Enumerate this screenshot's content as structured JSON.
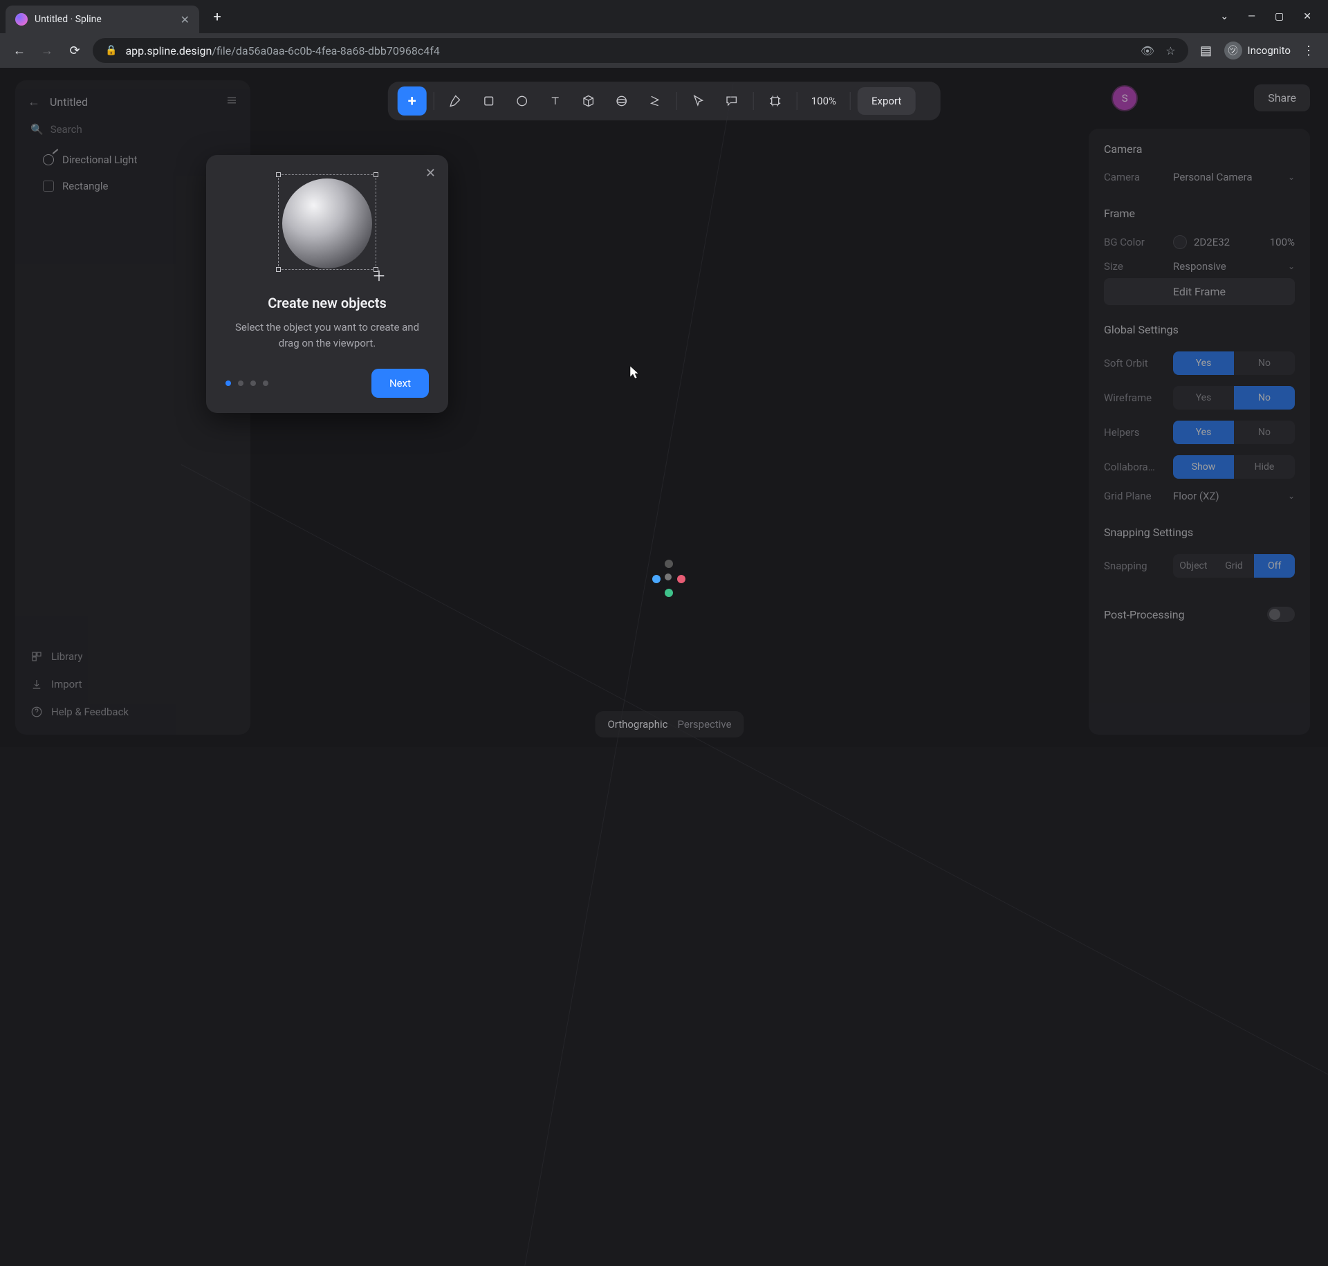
{
  "browser": {
    "tab_title": "Untitled · Spline",
    "url_host": "app.spline.design",
    "url_path": "/file/da56a0aa-6c0b-4fea-8a68-dbb70968c4f4",
    "incognito_label": "Incognito"
  },
  "left_panel": {
    "title": "Untitled",
    "search_placeholder": "Search",
    "items": [
      {
        "label": "Directional Light",
        "icon": "light"
      },
      {
        "label": "Rectangle",
        "icon": "rect"
      }
    ],
    "footer": {
      "library": "Library",
      "import": "Import",
      "help": "Help & Feedback"
    }
  },
  "toolbar": {
    "zoom": "100%",
    "export_label": "Export"
  },
  "share": {
    "avatar_initial": "S",
    "share_label": "Share"
  },
  "inspector": {
    "camera": {
      "section": "Camera",
      "label": "Camera",
      "value": "Personal Camera"
    },
    "frame": {
      "section": "Frame",
      "bgcolor_label": "BG Color",
      "bgcolor_hex": "2D2E32",
      "bgcolor_opacity": "100%",
      "size_label": "Size",
      "size_value": "Responsive",
      "edit_label": "Edit Frame"
    },
    "global": {
      "section": "Global Settings",
      "soft_orbit": {
        "label": "Soft Orbit",
        "yes": "Yes",
        "no": "No"
      },
      "wireframe": {
        "label": "Wireframe",
        "yes": "Yes",
        "no": "No"
      },
      "helpers": {
        "label": "Helpers",
        "yes": "Yes",
        "no": "No"
      },
      "collab": {
        "label": "Collabora…",
        "show": "Show",
        "hide": "Hide"
      },
      "grid_plane": {
        "label": "Grid Plane",
        "value": "Floor (XZ)"
      }
    },
    "snapping": {
      "section": "Snapping Settings",
      "label": "Snapping",
      "object": "Object",
      "grid": "Grid",
      "off": "Off"
    },
    "post": {
      "section": "Post-Processing"
    }
  },
  "view_modes": {
    "orthographic": "Orthographic",
    "perspective": "Perspective"
  },
  "popover": {
    "title": "Create new objects",
    "desc": "Select the object you want to create and drag on the viewport.",
    "next": "Next"
  }
}
